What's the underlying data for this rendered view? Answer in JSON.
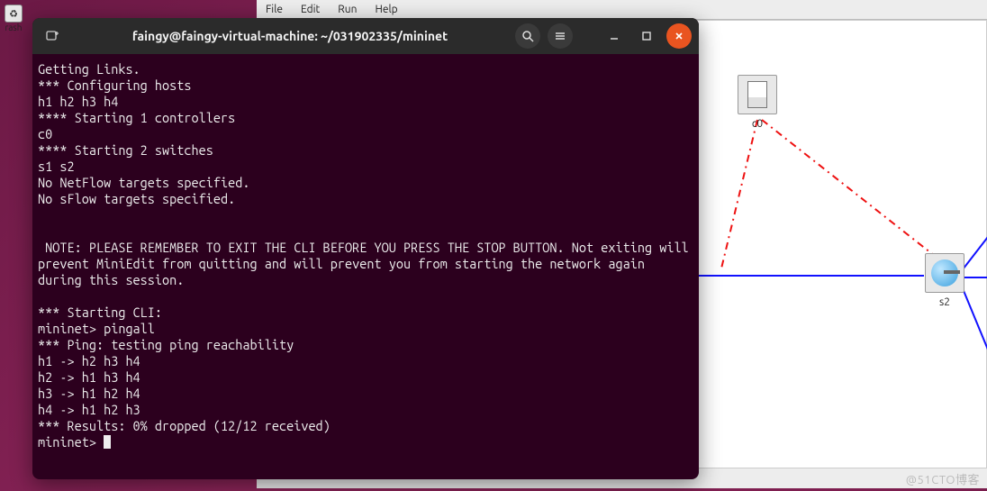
{
  "desktop": {
    "trash_label": "rash",
    "trash_glyph": "♻"
  },
  "miniedit": {
    "menu": {
      "file": "File",
      "edit": "Edit",
      "run": "Run",
      "help": "Help"
    },
    "nodes": {
      "c0": {
        "label": "c0"
      },
      "s2": {
        "label": "s2"
      }
    }
  },
  "terminal": {
    "title": "faingy@faingy-virtual-machine: ~/031902335/mininet",
    "icons": {
      "newtab": "new-tab-icon",
      "search": "search-icon",
      "menu": "hamburger-icon",
      "minimize": "minimize-icon",
      "maximize": "maximize-icon",
      "close": "close-icon"
    },
    "lines": [
      "Getting Links.",
      "*** Configuring hosts",
      "h1 h2 h3 h4",
      "**** Starting 1 controllers",
      "c0",
      "**** Starting 2 switches",
      "s1 s2",
      "No NetFlow targets specified.",
      "No sFlow targets specified.",
      "",
      "",
      " NOTE: PLEASE REMEMBER TO EXIT THE CLI BEFORE YOU PRESS THE STOP BUTTON. Not exiting will prevent MiniEdit from quitting and will prevent you from starting the network again during this session.",
      "",
      "*** Starting CLI:",
      "mininet> pingall",
      "*** Ping: testing ping reachability",
      "h1 -> h2 h3 h4",
      "h2 -> h1 h3 h4",
      "h3 -> h1 h2 h4",
      "h4 -> h1 h2 h3",
      "*** Results: 0% dropped (12/12 received)"
    ],
    "prompt": "mininet> "
  },
  "watermark": "@51CTO博客"
}
